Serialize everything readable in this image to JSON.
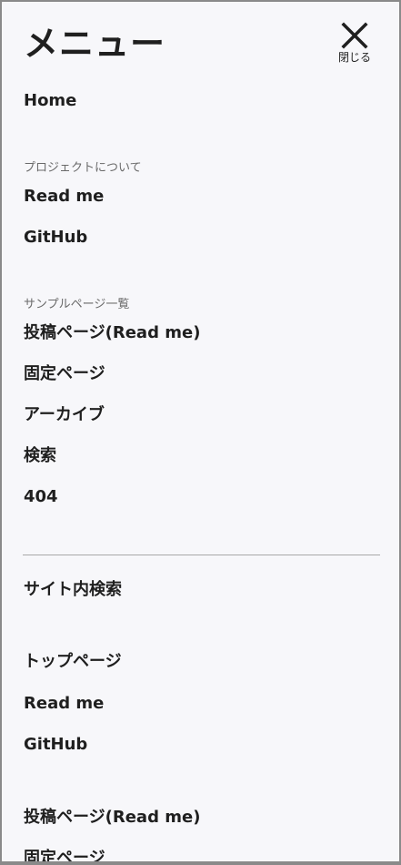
{
  "menu": {
    "title": "メニュー",
    "close_label": "閉じる"
  },
  "nav": {
    "home": "Home",
    "project_section_label": "プロジェクトについて",
    "project_items": [
      "Read me",
      "GitHub"
    ],
    "sample_section_label": "サンプルページ一覧",
    "sample_items": [
      "投稿ページ(Read me)",
      "固定ページ",
      "アーカイブ",
      "検索",
      "404"
    ]
  },
  "site_search": {
    "label": "サイト内検索"
  },
  "footer_nav": {
    "group1": [
      "トップページ",
      "Read me",
      "GitHub"
    ],
    "group2": [
      "投稿ページ(Read me)",
      "固定ページ"
    ]
  }
}
